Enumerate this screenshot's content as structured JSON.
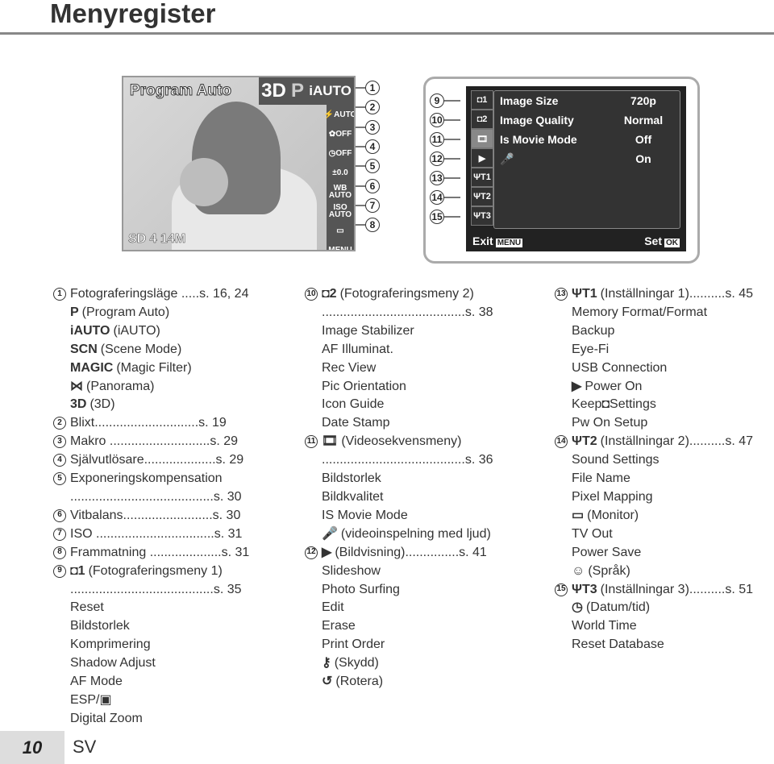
{
  "page_title": "Menyregister",
  "screen1": {
    "mode": "Program Auto",
    "top_icons": [
      "3D",
      "P",
      "iAUTO"
    ],
    "side_icons": [
      "⚡AUTO",
      "✿OFF",
      "◷OFF",
      "±0.0",
      "WB AUTO",
      "ISO AUTO",
      "▭",
      "MENU"
    ],
    "bottom": "SD 4 14M",
    "callouts": [
      "1",
      "2",
      "3",
      "4",
      "5",
      "6",
      "7",
      "8"
    ]
  },
  "screen2": {
    "tabs": [
      "◘1",
      "◘2",
      "🎞",
      "▶",
      "ΨT1",
      "ΨT2",
      "ΨT3"
    ],
    "callouts": [
      "9",
      "10",
      "11",
      "12",
      "13",
      "14",
      "15"
    ],
    "rows": [
      {
        "k": "Image Size",
        "v": "720p"
      },
      {
        "k": "Image Quality",
        "v": "Normal"
      },
      {
        "k": "Is Movie Mode",
        "v": "Off"
      },
      {
        "k": "🎤",
        "v": "On"
      }
    ],
    "exit": "Exit",
    "exit_key": "MENU",
    "set": "Set",
    "set_key": "OK"
  },
  "columns": [
    [
      {
        "n": "1",
        "t": "Fotograferingsläge .....s. 16, 24"
      },
      {
        "i": "P",
        "t": "(Program Auto)"
      },
      {
        "i": "iAUTO",
        "t": "(iAUTO)"
      },
      {
        "i": "SCN",
        "t": "(Scene Mode)"
      },
      {
        "i": "MAGIC",
        "t": "(Magic Filter)"
      },
      {
        "i": "⋈",
        "t": "(Panorama)"
      },
      {
        "i": "3D",
        "t": "(3D)"
      },
      {
        "n": "2",
        "t": "Blixt.............................s. 19"
      },
      {
        "n": "3",
        "t": "Makro ............................s. 29"
      },
      {
        "n": "4",
        "t": "Självutlösare....................s. 29"
      },
      {
        "n": "5",
        "t": "Exponeringskompensation"
      },
      {
        "t": "........................................s. 30"
      },
      {
        "n": "6",
        "t": "Vitbalans.........................s. 30"
      },
      {
        "n": "7",
        "t": "ISO .................................s. 31"
      },
      {
        "n": "8",
        "t": "Frammatning ....................s. 31"
      },
      {
        "n": "9",
        "i": "◘1",
        "t": "(Fotograferingsmeny 1)"
      },
      {
        "t": "........................................s. 35"
      },
      {
        "t": "Reset"
      },
      {
        "t": "Bildstorlek"
      },
      {
        "t": "Komprimering"
      },
      {
        "t": "Shadow Adjust"
      },
      {
        "t": "AF Mode"
      },
      {
        "t": "ESP/▣"
      },
      {
        "t": "Digital Zoom"
      }
    ],
    [
      {
        "n": "10",
        "i": "◘2",
        "t": "(Fotograferingsmeny 2)"
      },
      {
        "t": "........................................s. 38"
      },
      {
        "t": "Image Stabilizer"
      },
      {
        "t": "AF Illuminat."
      },
      {
        "t": "Rec View"
      },
      {
        "t": "Pic Orientation"
      },
      {
        "t": "Icon Guide"
      },
      {
        "t": "Date Stamp"
      },
      {
        "n": "11",
        "i": "🎞",
        "t": "(Videosekvensmeny)"
      },
      {
        "t": "........................................s. 36"
      },
      {
        "t": "Bildstorlek"
      },
      {
        "t": "Bildkvalitet"
      },
      {
        "t": "IS Movie Mode"
      },
      {
        "i": "🎤",
        "t": "(videoinspelning med ljud)"
      },
      {
        "n": "12",
        "i": "▶",
        "t": "(Bildvisning)...............s. 41"
      },
      {
        "t": "Slideshow"
      },
      {
        "t": "Photo Surfing"
      },
      {
        "t": "Edit"
      },
      {
        "t": "Erase"
      },
      {
        "t": "Print Order"
      },
      {
        "i": "⚷",
        "t": "(Skydd)"
      },
      {
        "i": "↺",
        "t": "(Rotera)"
      }
    ],
    [
      {
        "n": "13",
        "i": "ΨT1",
        "t": "(Inställningar 1)..........s. 45"
      },
      {
        "t": "Memory Format/Format"
      },
      {
        "t": "Backup"
      },
      {
        "t": "Eye-Fi"
      },
      {
        "t": "USB Connection"
      },
      {
        "i": "▶",
        "t": "Power On"
      },
      {
        "t": "Keep◘Settings"
      },
      {
        "t": "Pw On Setup"
      },
      {
        "n": "14",
        "i": "ΨT2",
        "t": "(Inställningar 2)..........s. 47"
      },
      {
        "t": "Sound Settings"
      },
      {
        "t": "File Name"
      },
      {
        "t": "Pixel Mapping"
      },
      {
        "i": "▭",
        "t": "(Monitor)"
      },
      {
        "t": "TV Out"
      },
      {
        "t": "Power Save"
      },
      {
        "i": "☺",
        "t": "(Språk)"
      },
      {
        "n": "15",
        "i": "ΨT3",
        "t": "(Inställningar 3)..........s. 51"
      },
      {
        "i": "◷",
        "t": "(Datum/tid)"
      },
      {
        "t": "World Time"
      },
      {
        "t": "Reset Database"
      }
    ]
  ],
  "footer": {
    "page_number": "10",
    "language": "SV"
  }
}
